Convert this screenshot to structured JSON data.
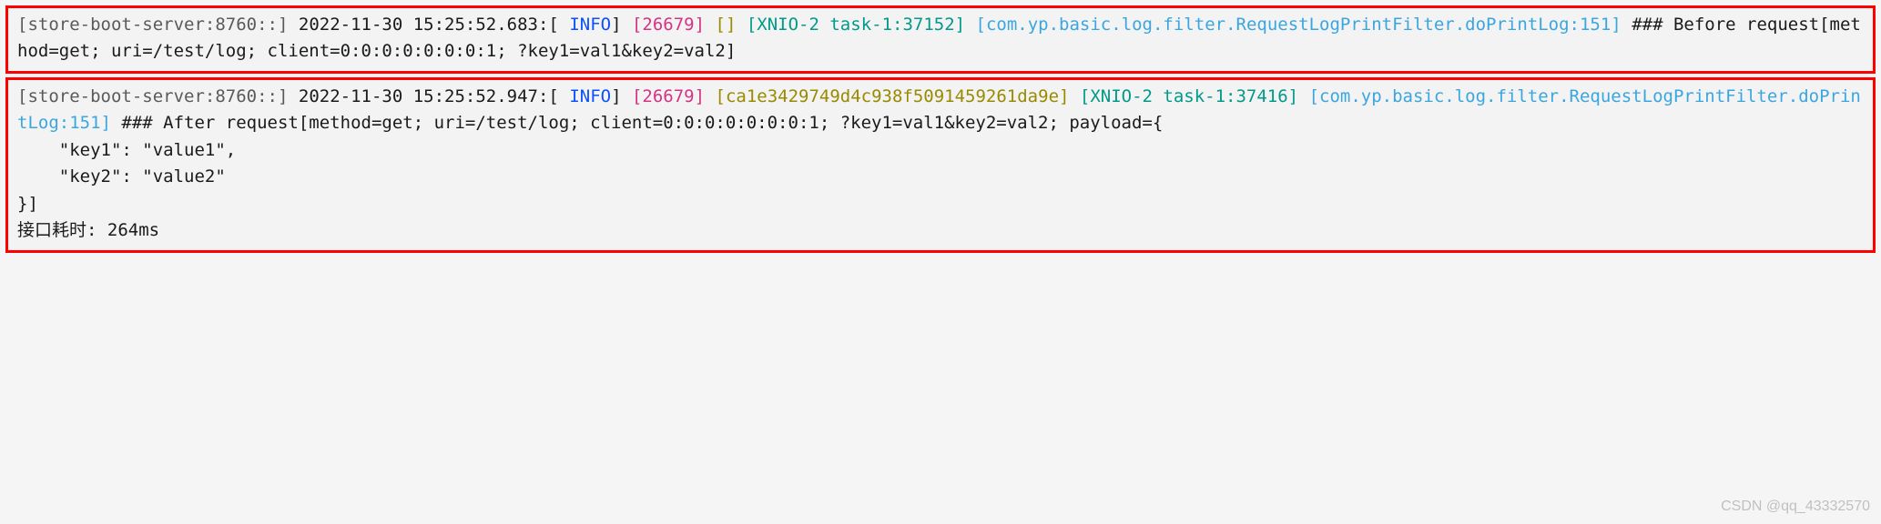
{
  "entry1": {
    "server": "[store-boot-server:8760::]",
    "ts": "2022-11-30 15:25:52.683:",
    "lvl_open": "[",
    "lvl": " INFO",
    "lvl_close": "]",
    "pid": "[26679]",
    "trace": "[]",
    "thread": "[XNIO-2 task-1:37152]",
    "logger": "[com.yp.basic.log.filter.RequestLogPrintFilter.doPrintLog:151]",
    "msg": "### Before request[method=get; uri=/test/log; client=0:0:0:0:0:0:0:1; ?key1=val1&key2=val2]"
  },
  "entry2": {
    "server": "[store-boot-server:8760::]",
    "ts": "2022-11-30 15:25:52.947:",
    "lvl_open": "[",
    "lvl": " INFO",
    "lvl_close": "]",
    "pid": "[26679]",
    "trace": "[ca1e3429749d4c938f5091459261da9e]",
    "thread": "[XNIO-2 task-1:37416]",
    "logger": "[com.yp.basic.log.filter.RequestLogPrintFilter.doPrintLog:151]",
    "msg": "### After request[method=get; uri=/test/log; client=0:0:0:0:0:0:0:1; ?key1=val1&key2=val2; payload={\n    \"key1\": \"value1\",\n    \"key2\": \"value2\"\n}]\n接口耗时: 264ms"
  },
  "watermark": "CSDN @qq_43332570"
}
